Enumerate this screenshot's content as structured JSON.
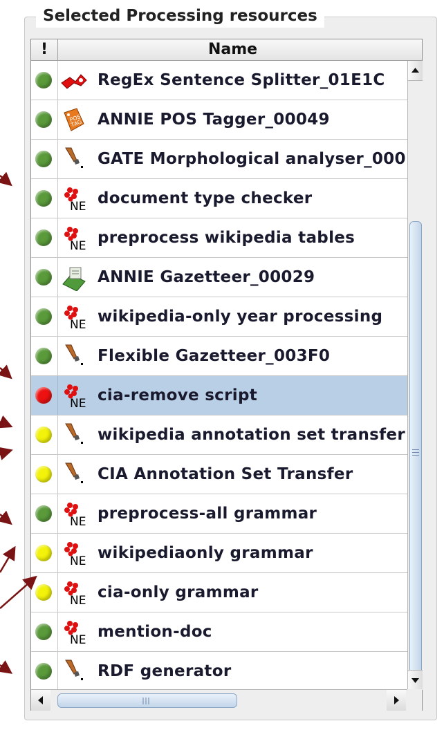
{
  "panel": {
    "title": "Selected Processing resources"
  },
  "table": {
    "columns": {
      "status": "!",
      "name": "Name"
    },
    "rows": [
      {
        "name": "RegEx Sentence Splitter_01E1C",
        "status": "green",
        "icon": "scissors-icon"
      },
      {
        "name": "ANNIE POS Tagger_00049",
        "status": "green",
        "icon": "pos-tag-icon"
      },
      {
        "name": "GATE Morphological analyser_000",
        "status": "green",
        "icon": "hammer-icon"
      },
      {
        "name": "document type checker",
        "status": "green",
        "icon": "jape-ne-icon"
      },
      {
        "name": "preprocess wikipedia tables",
        "status": "green",
        "icon": "jape-ne-icon"
      },
      {
        "name": "ANNIE Gazetteer_00029",
        "status": "green",
        "icon": "gazetteer-icon"
      },
      {
        "name": "wikipedia-only year processing",
        "status": "green",
        "icon": "jape-ne-icon"
      },
      {
        "name": "Flexible Gazetteer_003F0",
        "status": "green",
        "icon": "hammer-icon"
      },
      {
        "name": "cia-remove script",
        "status": "red",
        "icon": "jape-ne-icon",
        "selected": true
      },
      {
        "name": "wikipedia annotation set transfer",
        "status": "yellow",
        "icon": "hammer-icon"
      },
      {
        "name": "CIA Annotation Set Transfer",
        "status": "yellow",
        "icon": "hammer-icon"
      },
      {
        "name": "preprocess-all grammar",
        "status": "green",
        "icon": "jape-ne-icon"
      },
      {
        "name": "wikipediaonly grammar",
        "status": "yellow",
        "icon": "jape-ne-icon"
      },
      {
        "name": "cia-only grammar",
        "status": "yellow",
        "icon": "jape-ne-icon"
      },
      {
        "name": "mention-doc",
        "status": "green",
        "icon": "jape-ne-icon"
      },
      {
        "name": "RDF generator",
        "status": "green",
        "icon": "hammer-icon"
      }
    ]
  },
  "colors": {
    "green": "#5a9a3a",
    "red": "#ee1111",
    "yellow": "#f2f20a",
    "selected_row": "#b8cfe5",
    "annotation_arrow": "#7a1414"
  }
}
